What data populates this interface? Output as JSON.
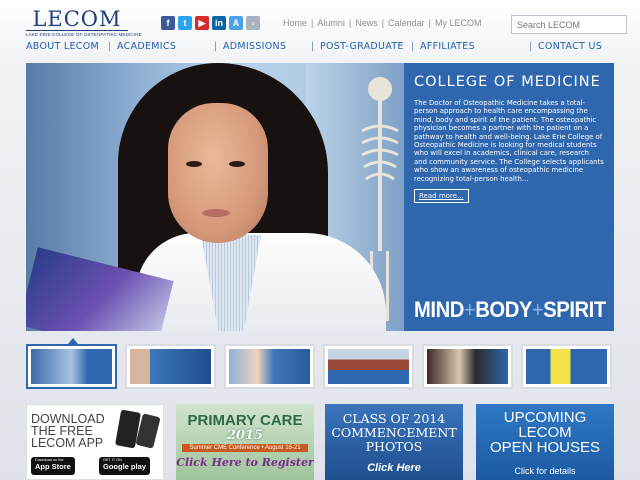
{
  "logo": {
    "wordmark": "LECOM",
    "subtitle": "LAKE ERIE COLLEGE OF OSTEOPATHIC MEDICINE"
  },
  "social": [
    {
      "name": "facebook-icon",
      "glyph": "f",
      "color": "#3b5998"
    },
    {
      "name": "twitter-icon",
      "glyph": "t",
      "color": "#2aa3ef"
    },
    {
      "name": "youtube-icon",
      "glyph": "▶",
      "color": "#d62b2b"
    },
    {
      "name": "linkedin-icon",
      "glyph": "in",
      "color": "#0a66a8"
    },
    {
      "name": "app-store-icon",
      "glyph": "A",
      "color": "#4aa3e8"
    },
    {
      "name": "mobile-app-icon",
      "glyph": "▫",
      "color": "#a9b3bf"
    }
  ],
  "utility_nav": [
    "Home",
    "Alumni",
    "News",
    "Calendar",
    "My LECOM"
  ],
  "search": {
    "placeholder": "Search LECOM"
  },
  "main_nav": [
    "ABOUT LECOM",
    "ACADEMICS",
    "ADMISSIONS",
    "POST-GRADUATE",
    "AFFILIATES",
    "CONTACT US"
  ],
  "hero": {
    "heading": "COLLEGE OF MEDICINE",
    "body": "The Doctor of Osteopathic Medicine takes a total-person approach to health care encompassing the mind, body and spirit of the patient. The osteopathic physician becomes a partner with the patient on a pathway to health and well-being. Lake Erie College of Osteopathic Medicine is looking for medical students who will excel in academics, clinical care, research and community service. The College selects applicants who show an awareness of osteopathic medicine recognizing total-person health...",
    "read_more": "Read more...",
    "tagline_1": "MIND",
    "tagline_2": "BODY",
    "tagline_3": "SPIRIT",
    "plus": "+"
  },
  "thumbnails": [
    {
      "name": "thumb-college-of-medicine",
      "active": true
    },
    {
      "name": "thumb-student-lab",
      "active": false
    },
    {
      "name": "thumb-student-lab-2",
      "active": false
    },
    {
      "name": "thumb-campus-building",
      "active": false
    },
    {
      "name": "thumb-award-ceremony",
      "active": false
    },
    {
      "name": "thumb-publication",
      "active": false
    }
  ],
  "promos": {
    "app": {
      "line1": "DOWNLOAD",
      "line2": "THE FREE",
      "line3": "LECOM APP",
      "appstore_small": "Download on the",
      "appstore": "App Store",
      "google_small": "GET IT ON",
      "google": "Google play"
    },
    "primary": {
      "line1": "PRIMARY CARE",
      "line2": "2015",
      "line3": "Summer CME Conference • August 16-21",
      "line4": "Click Here to Register"
    },
    "class": {
      "line1": "CLASS OF 2014",
      "line2": "COMMENCEMENT",
      "line3": "PHOTOS",
      "cta": "Click Here"
    },
    "open": {
      "line1": "UPCOMING",
      "line2": "LECOM",
      "line3": "OPEN HOUSES",
      "cta": "Click for details"
    }
  },
  "colors": {
    "brand_blue": "#2e67ad",
    "nav_blue": "#1f5fae",
    "logo_navy": "#1e3f7a"
  }
}
